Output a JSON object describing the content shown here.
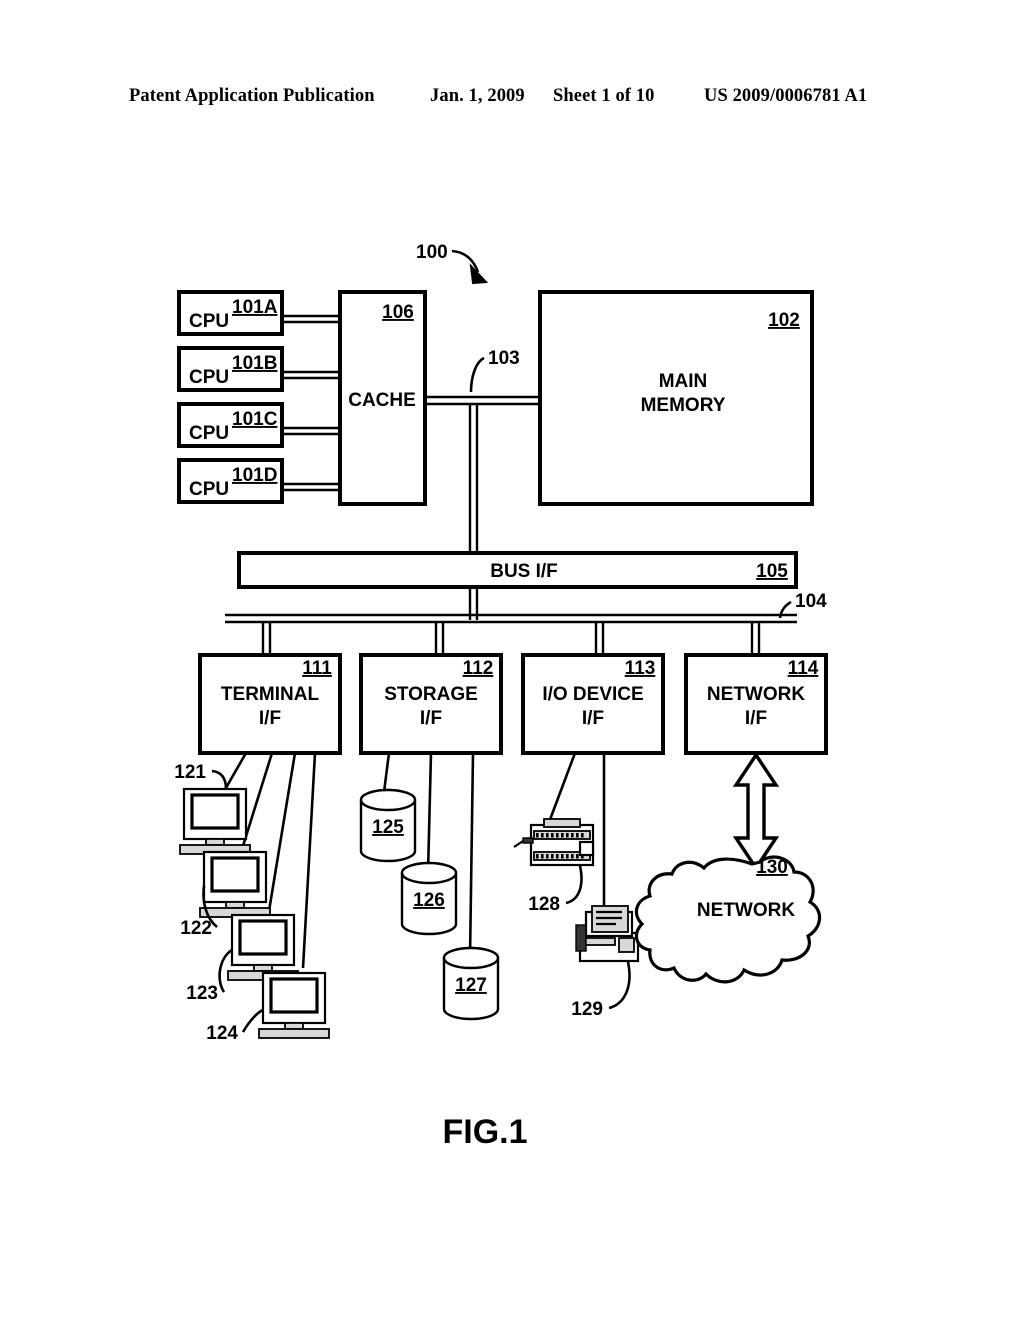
{
  "header": {
    "publication": "Patent Application Publication",
    "date": "Jan. 1, 2009",
    "sheet": "Sheet 1 of 10",
    "patent_number": "US 2009/0006781 A1"
  },
  "figure": {
    "label": "FIG.1",
    "system_ref": "100",
    "cpus": [
      {
        "label": "CPU",
        "ref": "101A"
      },
      {
        "label": "CPU",
        "ref": "101B"
      },
      {
        "label": "CPU",
        "ref": "101C"
      },
      {
        "label": "CPU",
        "ref": "101D"
      }
    ],
    "cache": {
      "label": "CACHE",
      "ref": "106"
    },
    "memory": {
      "line1": "MAIN",
      "line2": "MEMORY",
      "ref": "102"
    },
    "memory_bus_ref": "103",
    "bus_if": {
      "label": "BUS I/F",
      "ref": "105"
    },
    "io_bus_ref": "104",
    "interfaces": [
      {
        "line1": "TERMINAL",
        "line2": "I/F",
        "ref": "111"
      },
      {
        "line1": "STORAGE",
        "line2": "I/F",
        "ref": "112"
      },
      {
        "line1": "I/O DEVICE",
        "line2": "I/F",
        "ref": "113"
      },
      {
        "line1": "NETWORK",
        "line2": "I/F",
        "ref": "114"
      }
    ],
    "terminals": [
      {
        "ref": "121"
      },
      {
        "ref": "122"
      },
      {
        "ref": "123"
      },
      {
        "ref": "124"
      }
    ],
    "storage_devices": [
      {
        "ref": "125"
      },
      {
        "ref": "126"
      },
      {
        "ref": "127"
      }
    ],
    "io_devices": [
      {
        "ref": "128"
      },
      {
        "ref": "129"
      }
    ],
    "network": {
      "label": "NETWORK",
      "ref": "130"
    }
  }
}
